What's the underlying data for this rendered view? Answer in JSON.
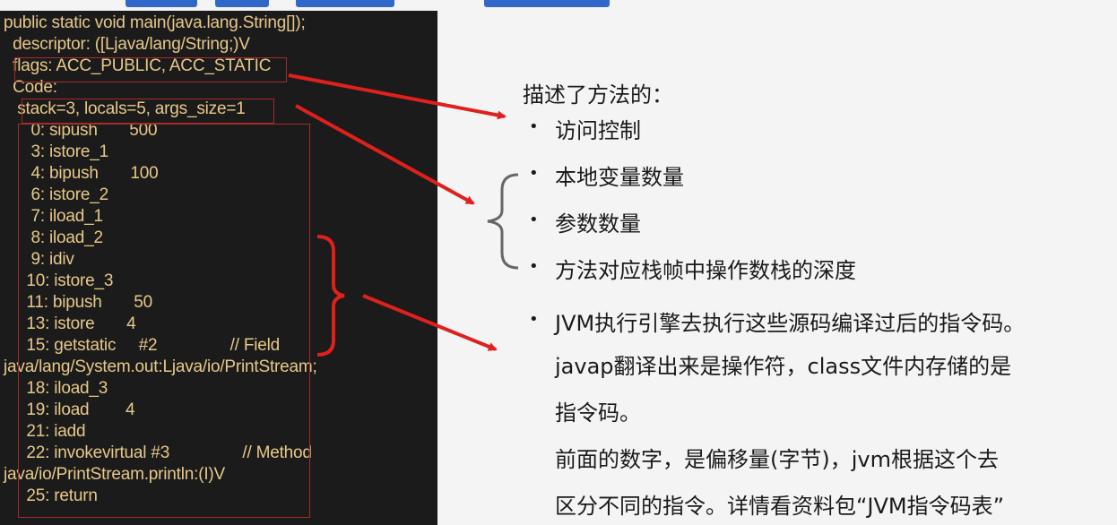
{
  "code_lines": [
    "public static void main(java.lang.String[]);",
    "  descriptor: ([Ljava/lang/String;)V",
    "  flags: ACC_PUBLIC, ACC_STATIC",
    "  Code:",
    "   stack=3, locals=5, args_size=1",
    "      0: sipush       500",
    "      3: istore_1",
    "      4: bipush       100",
    "      6: istore_2",
    "      7: iload_1",
    "      8: iload_2",
    "      9: idiv",
    "     10: istore_3",
    "     11: bipush       50",
    "     13: istore       4",
    "     15: getstatic     #2                // Field",
    "java/lang/System.out:Ljava/io/PrintStream;",
    "     18: iload_3",
    "     19: iload        4",
    "     21: iadd",
    "     22: invokevirtual #3                // Method",
    "java/io/PrintStream.println:(I)V",
    "     25: return"
  ],
  "description": {
    "heading": "描述了方法的：",
    "bullet_symbol": "•",
    "items": [
      "访问控制",
      "本地变量数量",
      "参数数量",
      "方法对应栈帧中操作数栈的深度",
      "JVM执行引擎去执行这些源码编译过后的指令码。"
    ],
    "continuation": [
      "javap翻译出来是操作符，class文件内存储的是",
      "指令码。",
      "前面的数字，是偏移量(字节)，jvm根据这个去",
      "区分不同的指令。详情看资料包“JVM指令码表”"
    ]
  },
  "colors": {
    "code_bg": "#1b1b1b",
    "code_text": "#e8c88a",
    "annotation": "#e0201c",
    "box_border": "#a82a2a",
    "title_blue": "#2f68c9"
  }
}
